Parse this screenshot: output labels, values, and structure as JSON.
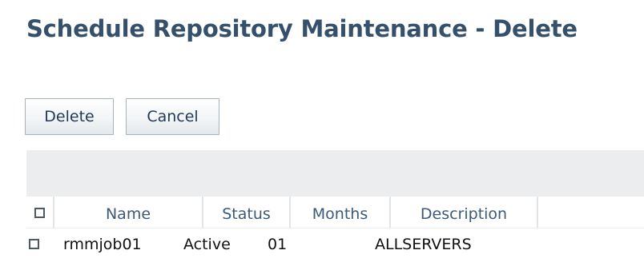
{
  "page": {
    "title": "Schedule Repository Maintenance - Delete"
  },
  "toolbar": {
    "delete_label": "Delete",
    "cancel_label": "Cancel"
  },
  "table": {
    "columns": [
      "Name",
      "Status",
      "Months",
      "Description"
    ],
    "rows": [
      {
        "checked": false,
        "name": "rmmjob01",
        "status": "Active",
        "months": "01",
        "description": "ALLSERVERS"
      }
    ]
  },
  "colors": {
    "title": "#35506b",
    "header_text": "#3c5a78",
    "band": "#ebedef",
    "button_border": "#a7b3bd"
  }
}
